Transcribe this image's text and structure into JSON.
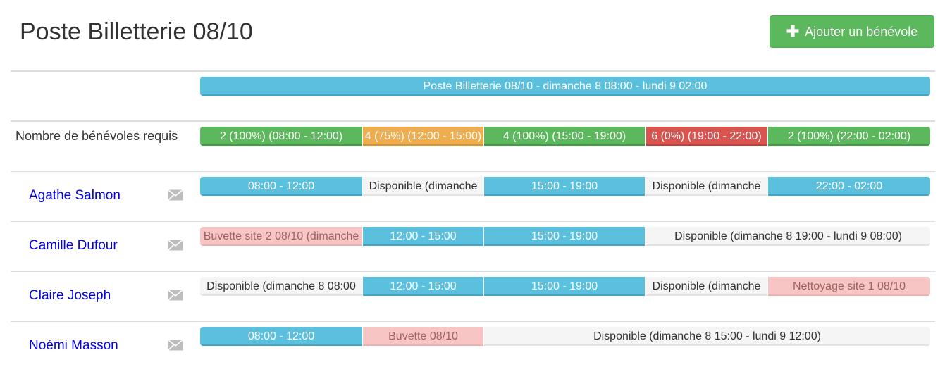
{
  "page": {
    "title": "Poste Billetterie 08/10",
    "add_button": {
      "icon": "plus-icon",
      "label": "Ajouter un bénévole"
    }
  },
  "poste_bar": {
    "label": "Poste Billetterie 08/10 - dimanche 8 08:00 - lundi 9 02:00",
    "color": "#5bc0de"
  },
  "required": {
    "label": "Nombre de bénévoles requis",
    "slots": [
      {
        "label": "2 (100%) (08:00 - 12:00)",
        "status": "success",
        "color": "#5cb85c"
      },
      {
        "label": "4 (75%) (12:00 - 15:00)",
        "status": "warning",
        "color": "#f0ad4e"
      },
      {
        "label": "4 (100%) (15:00 - 19:00)",
        "status": "success",
        "color": "#5cb85c"
      },
      {
        "label": "6 (0%) (19:00 - 22:00)",
        "status": "danger",
        "color": "#d9534f"
      },
      {
        "label": "2 (100%) (22:00 - 02:00)",
        "status": "success",
        "color": "#5cb85c"
      }
    ]
  },
  "volunteers": [
    {
      "name": "Agathe Salmon",
      "mail_icon": "envelope-icon",
      "slots": [
        {
          "label": "08:00 - 12:00",
          "kind": "assigned"
        },
        {
          "label": "Disponible (dimanche",
          "kind": "available"
        },
        {
          "label": "15:00 - 19:00",
          "kind": "assigned"
        },
        {
          "label": "Disponible (dimanche",
          "kind": "available"
        },
        {
          "label": "22:00 - 02:00",
          "kind": "assigned"
        }
      ]
    },
    {
      "name": "Camille Dufour",
      "mail_icon": "envelope-icon",
      "slots": [
        {
          "label": "Buvette site 2 08/10 (dimanche",
          "kind": "other-post"
        },
        {
          "label": "12:00 - 15:00",
          "kind": "assigned"
        },
        {
          "label": "15:00 - 19:00",
          "kind": "assigned"
        },
        {
          "label": "Disponible (dimanche 8 19:00 - lundi 9 08:00)",
          "kind": "available"
        }
      ]
    },
    {
      "name": "Claire Joseph",
      "mail_icon": "envelope-icon",
      "slots": [
        {
          "label": "Disponible (dimanche 8 08:00",
          "kind": "available"
        },
        {
          "label": "12:00 - 15:00",
          "kind": "assigned"
        },
        {
          "label": "15:00 - 19:00",
          "kind": "assigned"
        },
        {
          "label": "Disponible (dimanche",
          "kind": "available"
        },
        {
          "label": "Nettoyage site 1 08/10",
          "kind": "other-post"
        }
      ]
    },
    {
      "name": "Noémi Masson",
      "mail_icon": "envelope-icon",
      "slots": [
        {
          "label": "08:00 - 12:00",
          "kind": "assigned"
        },
        {
          "label": "Buvette 08/10",
          "kind": "other-post"
        },
        {
          "label": "Disponible (dimanche 8 15:00 - lundi 9 12:00)",
          "kind": "available"
        }
      ]
    }
  ]
}
